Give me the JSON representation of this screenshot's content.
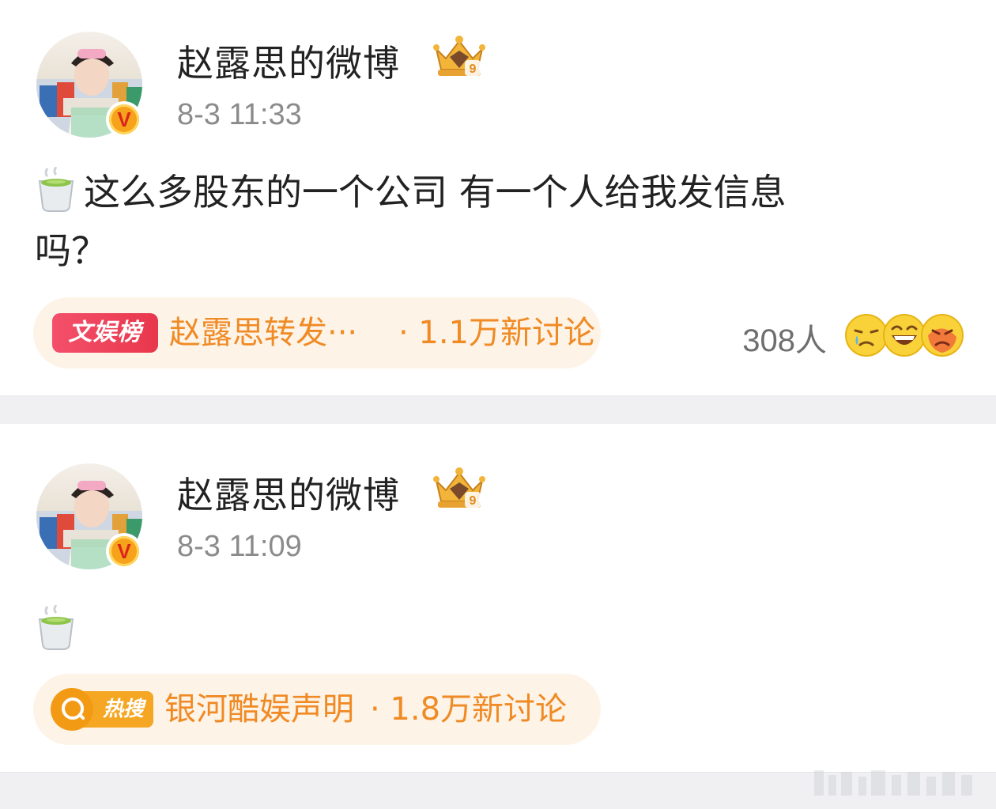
{
  "posts": [
    {
      "username": "赵露思的微博",
      "verified_badge": "V",
      "level_badge": "9",
      "timestamp": "8-3 11:33",
      "content_icon": "tea-emoji",
      "content_line1": "这么多股东的一个公司 有一个人给我发信息",
      "content_line2": "吗？",
      "topic_tag": "文娱榜",
      "topic_text": "赵露思转发···",
      "topic_stats": "· 1.1万新讨论",
      "reactions_count": "308人",
      "reaction_icons": [
        "crying-emoji",
        "laughing-emoji",
        "angry-emoji"
      ]
    },
    {
      "username": "赵露思的微博",
      "verified_badge": "V",
      "level_badge": "9",
      "timestamp": "8-3 11:09",
      "content_icon": "tea-emoji",
      "topic_tag": "热搜",
      "topic_text": "银河酷娱声明",
      "topic_stats": "· 1.8万新讨论"
    }
  ],
  "colors": {
    "topic_text": "#f08a24",
    "topic_pill_bg": "#fdf3e7",
    "wenyu_tag": "#e8374c",
    "resou_tag": "#f5a623",
    "separator": "#f0f0f2"
  }
}
